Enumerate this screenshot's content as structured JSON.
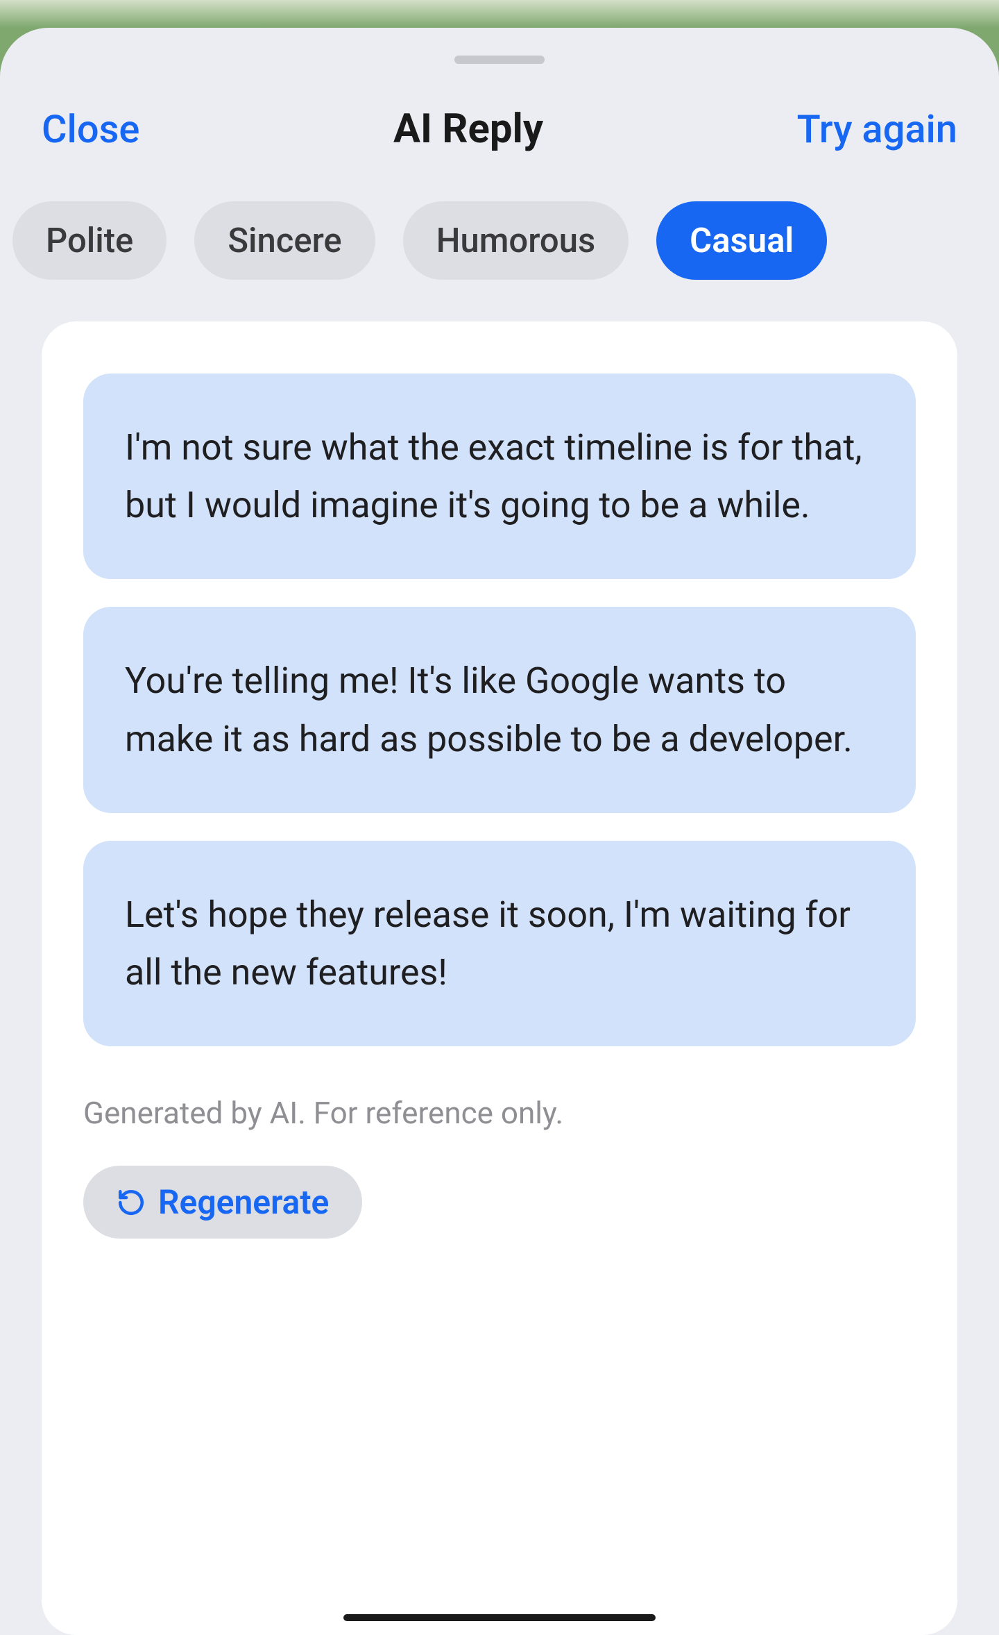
{
  "header": {
    "close": "Close",
    "title": "AI Reply",
    "tryAgain": "Try again"
  },
  "tones": [
    {
      "label": "Polite",
      "active": false
    },
    {
      "label": "Sincere",
      "active": false
    },
    {
      "label": "Humorous",
      "active": false
    },
    {
      "label": "Casual",
      "active": true
    }
  ],
  "suggestions": [
    "I'm not sure what the exact timeline is for that, but I would imagine it's going to be a while.",
    "You're telling me! It's like Google wants to make it as hard as possible to be a developer.",
    "Let's hope they release it soon, I'm waiting for all the new features!"
  ],
  "disclaimer": "Generated by AI. For reference only.",
  "regenerate": "Regenerate"
}
